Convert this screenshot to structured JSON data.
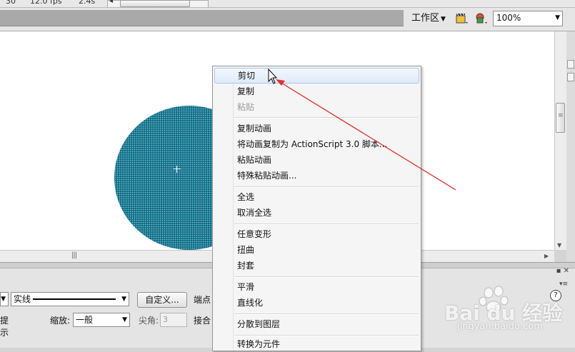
{
  "timeline": {
    "frame": "30",
    "fps": "12.0 fps",
    "time": "2.4s"
  },
  "editbar": {
    "workspace_label": "工作区",
    "zoom_value": "100%"
  },
  "context_menu": {
    "items": [
      {
        "label": "剪切",
        "enabled": true,
        "hover": true
      },
      {
        "label": "复制",
        "enabled": true
      },
      {
        "label": "粘贴",
        "enabled": false
      },
      {
        "label": "复制动画",
        "enabled": true
      },
      {
        "label": "将动画复制为 ActionScript 3.0 脚本...",
        "enabled": true
      },
      {
        "label": "粘贴动画",
        "enabled": true
      },
      {
        "label": "特殊粘贴动画...",
        "enabled": true
      },
      {
        "label": "全选",
        "enabled": true
      },
      {
        "label": "取消全选",
        "enabled": true
      },
      {
        "label": "任意变形",
        "enabled": true
      },
      {
        "label": "扭曲",
        "enabled": true
      },
      {
        "label": "封套",
        "enabled": true
      },
      {
        "label": "平滑",
        "enabled": true
      },
      {
        "label": "直线化",
        "enabled": true
      },
      {
        "label": "分散到图层",
        "enabled": true
      },
      {
        "label": "转换为元件",
        "enabled": true
      }
    ]
  },
  "properties": {
    "stroke_style": "实线",
    "custom_button": "自定义...",
    "cap_label": "端点",
    "hint_label": "提示",
    "scale_label": "缩放:",
    "scale_value": "一般",
    "miter_label": "尖角:",
    "miter_value": "3",
    "join_label": "接合"
  },
  "watermark": {
    "brand": "Bai du 经验",
    "url": "jingyan.baidu.com"
  },
  "colors": {
    "circle_fill": "#0b6f89",
    "annotation_arrow": "#e03030",
    "menu_hover": "#dfeaf8"
  }
}
